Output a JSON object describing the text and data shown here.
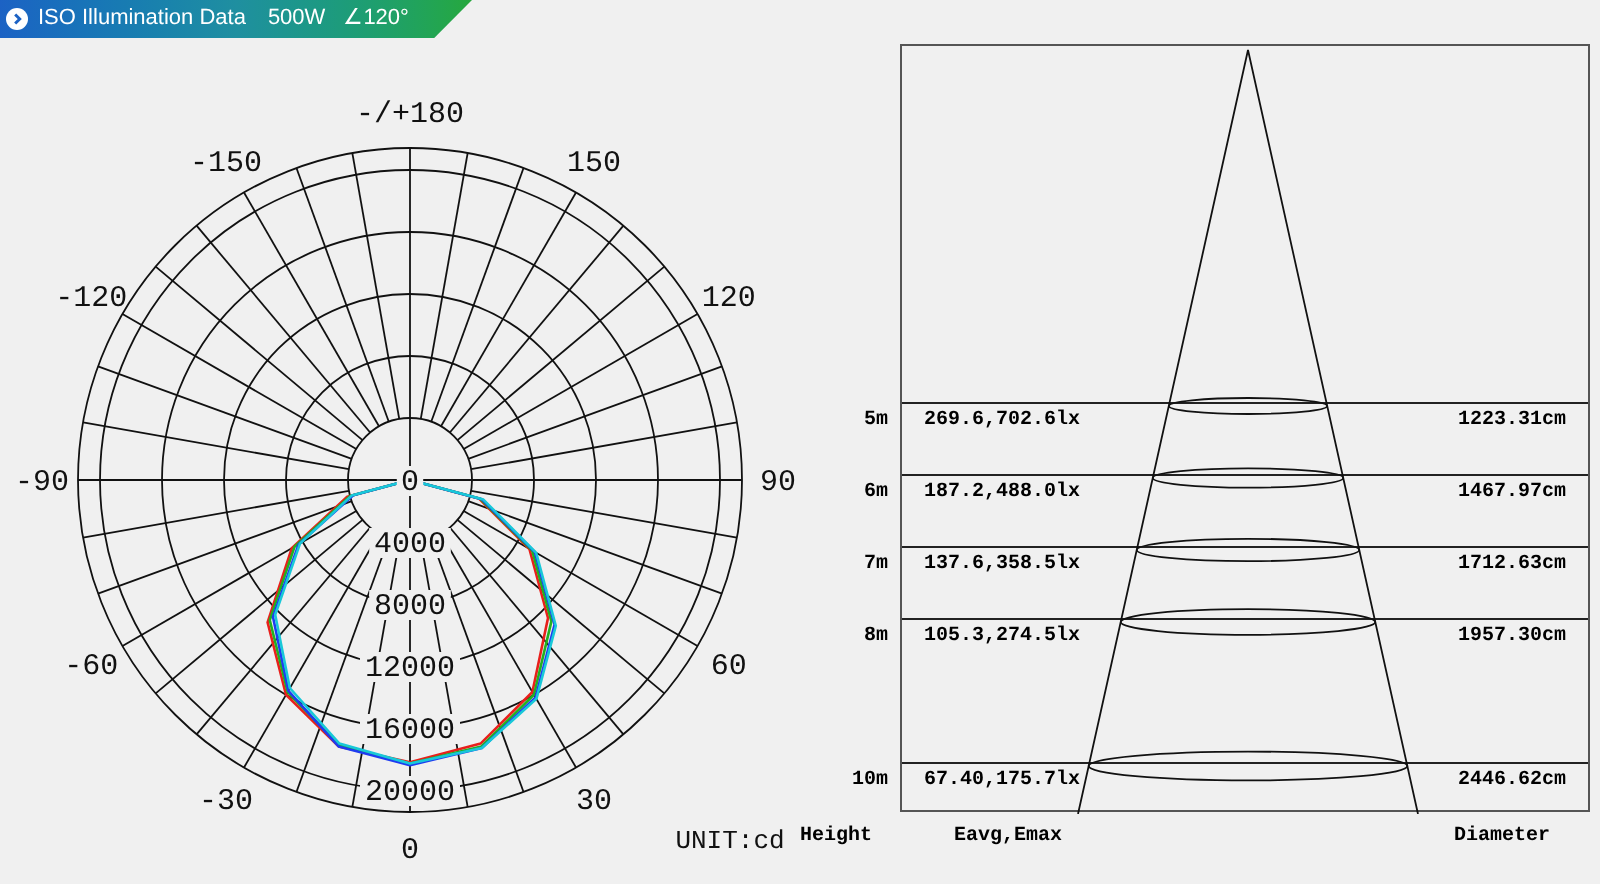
{
  "header": {
    "title": "ISO Illumination Data",
    "power": "500W",
    "beam_angle": "∠120°"
  },
  "polar": {
    "unit": "UNIT:cd",
    "angle_labels": [
      "-/+180",
      "-150",
      "-120",
      "-90",
      "-60",
      "-30",
      "0",
      "30",
      "60",
      "90",
      "120",
      "150"
    ],
    "radial_labels": [
      "0",
      "4000",
      "8000",
      "12000",
      "16000",
      "20000"
    ],
    "curves": [
      {
        "color": "#e8201c"
      },
      {
        "color": "#22b022"
      },
      {
        "color": "#1e3cf0"
      },
      {
        "color": "#18c8d8"
      }
    ]
  },
  "cone": {
    "columns": [
      "Height",
      "Eavg,Emax",
      "Diameter"
    ],
    "rows": [
      {
        "height": "5m",
        "illuminance": "269.6,702.6lx",
        "diameter": "1223.31cm"
      },
      {
        "height": "6m",
        "illuminance": "187.2,488.0lx",
        "diameter": "1467.97cm"
      },
      {
        "height": "7m",
        "illuminance": "137.6,358.5lx",
        "diameter": "1712.63cm"
      },
      {
        "height": "8m",
        "illuminance": "105.3,274.5lx",
        "diameter": "1957.30cm"
      },
      {
        "height": "10m",
        "illuminance": "67.40,175.7lx",
        "diameter": "2446.62cm"
      }
    ]
  }
}
